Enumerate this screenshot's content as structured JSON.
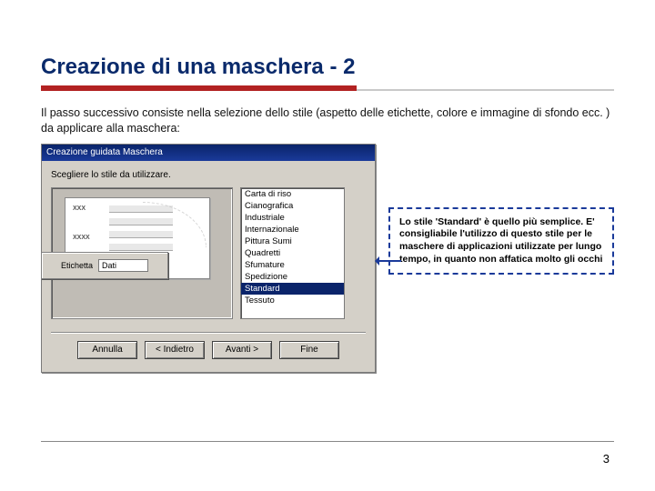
{
  "title": "Creazione di una maschera - 2",
  "intro": "Il passo successivo consiste nella selezione dello stile (aspetto delle etichette, colore e immagine di sfondo ecc. ) da applicare alla maschera:",
  "dialog": {
    "titlebar": "Creazione guidata Maschera",
    "prompt": "Scegliere lo stile da utilizzare.",
    "preview": {
      "lbl1": "XXX",
      "lbl2": "XXXX",
      "popup_label": "Etichetta",
      "popup_value": "Dati"
    },
    "styles": [
      "Carta di riso",
      "Cianografica",
      "Industriale",
      "Internazionale",
      "Pittura Sumi",
      "Quadretti",
      "Sfumature",
      "Spedizione",
      "Standard",
      "Tessuto"
    ],
    "selected_style_index": 8,
    "buttons": {
      "cancel": "Annulla",
      "back": "< Indietro",
      "next": "Avanti >",
      "finish": "Fine"
    }
  },
  "annotation": "Lo stile 'Standard' è quello più semplice. E' consigliabile l'utilizzo di questo stile per le maschere di applicazioni utilizzate per lungo tempo, in quanto non affatica molto gli occhi",
  "page_number": "3"
}
